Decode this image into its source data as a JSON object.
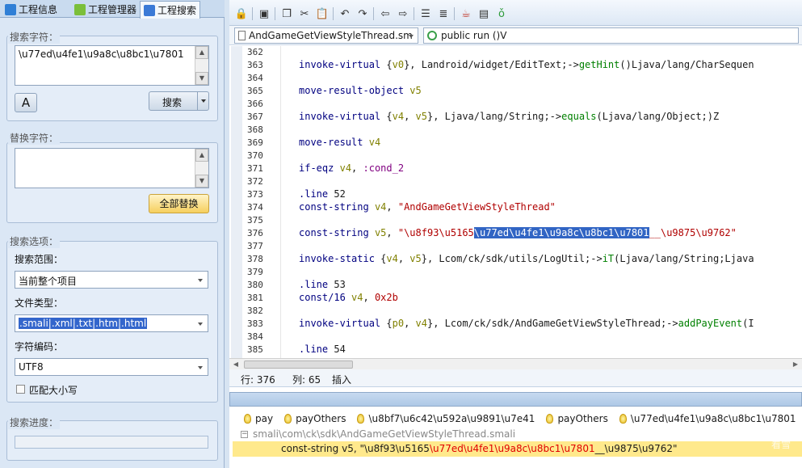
{
  "left_tabs": [
    {
      "label": "工程信息",
      "icon": "info-icon"
    },
    {
      "label": "工程管理器",
      "icon": "android-icon"
    },
    {
      "label": "工程搜索",
      "icon": "search-icon"
    }
  ],
  "search": {
    "group_label": "搜索字符：",
    "text": "\\u77ed\\u4fe1\\u9a8c\\u8bc1\\u7801",
    "button": "搜索"
  },
  "replace": {
    "group_label": "替换字符：",
    "text": "",
    "button": "全部替换"
  },
  "options": {
    "group_label": "搜索选项：",
    "scope_label": "搜索范围：",
    "scope_value": "当前整个项目",
    "filetype_label": "文件类型：",
    "filetype_value": ".smali|.xml|.txt|.htm|.html",
    "encoding_label": "字符编码：",
    "encoding_value": "UTF8",
    "match_case_label": "匹配大小写",
    "match_case": false
  },
  "progress": {
    "group_label": "搜索进度：",
    "value": 0
  },
  "editor": {
    "file_tab": "AndGameGetViewStyleThread.sm",
    "method": "public run ()V",
    "lines": [
      {
        "n": "362",
        "code": ""
      },
      {
        "n": "363",
        "code": "invoke-virtual {v0}, Landroid/widget/EditText;->getHint()Ljava/lang/CharSequen"
      },
      {
        "n": "364",
        "code": ""
      },
      {
        "n": "365",
        "code": "move-result-object v5"
      },
      {
        "n": "366",
        "code": ""
      },
      {
        "n": "367",
        "code": "invoke-virtual {v4, v5}, Ljava/lang/String;->equals(Ljava/lang/Object;)Z"
      },
      {
        "n": "368",
        "code": ""
      },
      {
        "n": "369",
        "code": "move-result v4"
      },
      {
        "n": "370",
        "code": ""
      },
      {
        "n": "371",
        "code": "if-eqz v4, :cond_2"
      },
      {
        "n": "372",
        "code": ""
      },
      {
        "n": "373",
        "code": ".line 52"
      },
      {
        "n": "374",
        "code": "const-string v4, \"AndGameGetViewStyleThread\""
      },
      {
        "n": "375",
        "code": ""
      },
      {
        "n": "376",
        "code": "const-string v5, \"\\u8f93\\u5165\\u77ed\\u4fe1\\u9a8c\\u8bc1\\u7801__\\u9875\\u9762\""
      },
      {
        "n": "377",
        "code": ""
      },
      {
        "n": "378",
        "code": "invoke-static {v4, v5}, Lcom/ck/sdk/utils/LogUtil;->iT(Ljava/lang/String;Ljava"
      },
      {
        "n": "379",
        "code": ""
      },
      {
        "n": "380",
        "code": ".line 53"
      },
      {
        "n": "381",
        "code": "const/16 v4, 0x2b"
      },
      {
        "n": "382",
        "code": ""
      },
      {
        "n": "383",
        "code": "invoke-virtual {p0, v4}, Lcom/ck/sdk/AndGameGetViewStyleThread;->addPayEvent(I"
      },
      {
        "n": "384",
        "code": ""
      },
      {
        "n": "385",
        "code": ".line 54"
      }
    ]
  },
  "status": {
    "row_label": "行: 376",
    "col_label": "列: 65",
    "mode": "插入"
  },
  "results": {
    "tabs": [
      "pay",
      "payOthers",
      "\\u8bf7\\u6c42\\u592a\\u9891\\u7e41",
      "payOthers",
      "\\u77ed\\u4fe1\\u9a8c\\u8bc1\\u7801"
    ],
    "file_path": "smali\\com\\ck\\sdk\\AndGameGetViewStyleThread.smali",
    "match_prefix": "const-string v5, \"\\u8f93\\u5165",
    "match_hit": "\\u77ed\\u4fe1\\u9a8c\\u8bc1\\u7801",
    "match_suffix": "__\\u9875\\u9762\"",
    "watermark": "看雪"
  }
}
